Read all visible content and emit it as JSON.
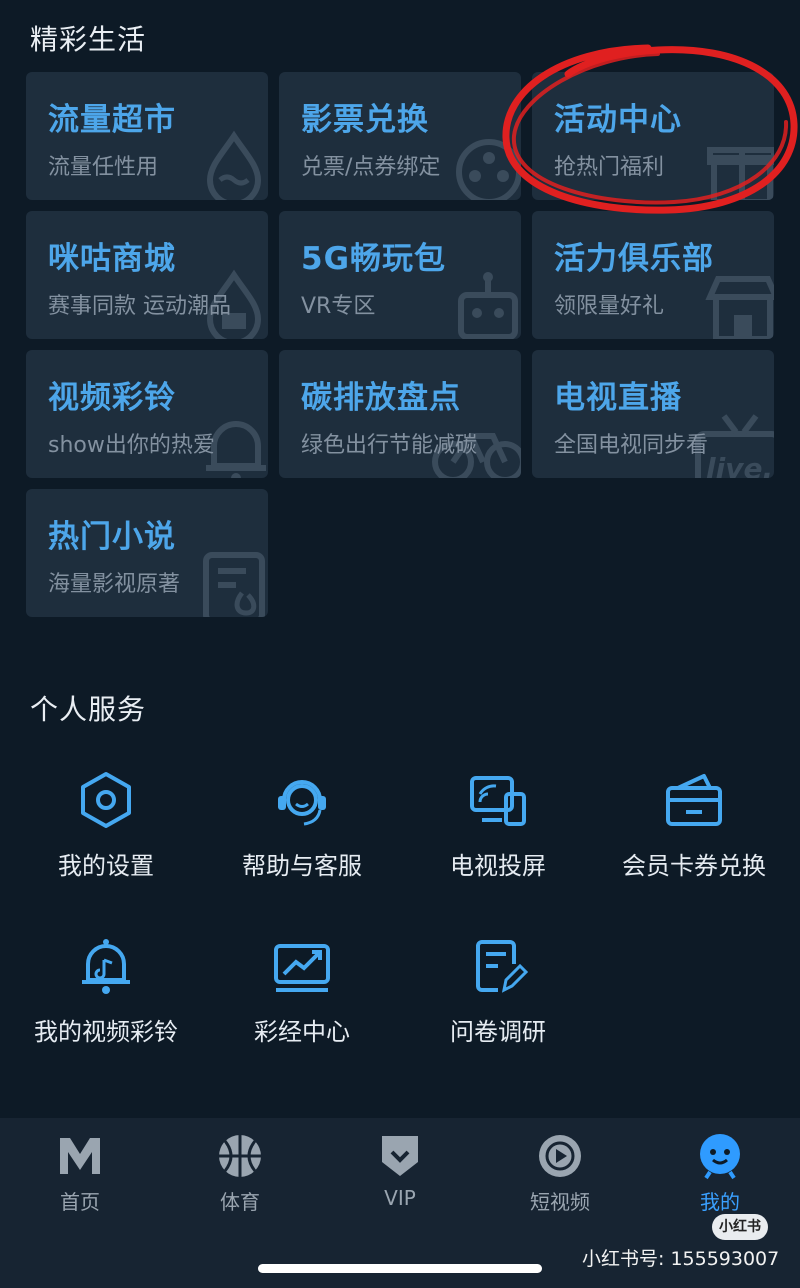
{
  "wonderful_life": {
    "title": "精彩生活",
    "cards": [
      {
        "title": "流量超市",
        "subtitle": "流量任性用",
        "icon": "droplet-icon"
      },
      {
        "title": "影票兑换",
        "subtitle": "兑票/点券绑定",
        "icon": "film-reel-icon"
      },
      {
        "title": "活动中心",
        "subtitle": "抢热门福利",
        "icon": "gift-icon"
      },
      {
        "title": "咪咕商城",
        "subtitle": "赛事同款 运动潮品",
        "icon": "droplet-icon"
      },
      {
        "title": "5G畅玩包",
        "subtitle": "VR专区",
        "icon": "robot-icon"
      },
      {
        "title": "活力俱乐部",
        "subtitle": "领限量好礼",
        "icon": "shop-icon"
      },
      {
        "title": "视频彩铃",
        "subtitle": "show出你的热爱",
        "icon": "bell-icon"
      },
      {
        "title": "碳排放盘点",
        "subtitle": "绿色出行节能减碳",
        "icon": "bicycle-icon"
      },
      {
        "title": "电视直播",
        "subtitle": "全国电视同步看",
        "icon": "tv-live-icon"
      },
      {
        "title": "热门小说",
        "subtitle": "海量影视原著",
        "icon": "book-icon"
      }
    ],
    "live_badge_text": "live."
  },
  "personal_services": {
    "title": "个人服务",
    "items": [
      {
        "label": "我的设置",
        "icon": "settings-hexagon-icon"
      },
      {
        "label": "帮助与客服",
        "icon": "customer-service-icon"
      },
      {
        "label": "电视投屏",
        "icon": "screen-cast-icon"
      },
      {
        "label": "会员卡券兑换",
        "icon": "wallet-card-icon"
      },
      {
        "label": "我的视频彩铃",
        "icon": "music-bell-icon"
      },
      {
        "label": "彩经中心",
        "icon": "trend-chart-icon"
      },
      {
        "label": "问卷调研",
        "icon": "survey-icon"
      }
    ]
  },
  "tabbar": {
    "tabs": [
      {
        "label": "首页",
        "icon": "migu-logo-icon",
        "active": false
      },
      {
        "label": "体育",
        "icon": "basketball-icon",
        "active": false
      },
      {
        "label": "VIP",
        "icon": "vip-badge-icon",
        "active": false
      },
      {
        "label": "短视频",
        "icon": "play-circle-icon",
        "active": false
      },
      {
        "label": "我的",
        "icon": "mascot-face-icon",
        "active": true
      }
    ]
  },
  "watermark": {
    "badge": "小红书",
    "text": "小红书号: 155593007"
  },
  "colors": {
    "background": "#0d1a26",
    "card": "#1e2e3d",
    "accent": "#4da6ea",
    "annotation": "#e02020"
  }
}
